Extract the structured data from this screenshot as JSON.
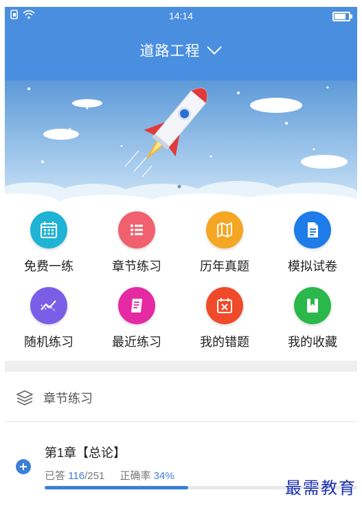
{
  "status": {
    "time": "14:14"
  },
  "header": {
    "title": "道路工程"
  },
  "menu": [
    {
      "label": "免费一练",
      "icon": "calendar-icon",
      "color": "#1fb3d6"
    },
    {
      "label": "章节练习",
      "icon": "list-icon",
      "color": "#f0606f"
    },
    {
      "label": "历年真题",
      "icon": "map-icon",
      "color": "#f5a623"
    },
    {
      "label": "模拟试卷",
      "icon": "document-icon",
      "color": "#1e7be8"
    },
    {
      "label": "随机练习",
      "icon": "random-chart-icon",
      "color": "#7a5ee8"
    },
    {
      "label": "最近练习",
      "icon": "book-icon",
      "color": "#e52aa4"
    },
    {
      "label": "我的错题",
      "icon": "error-calendar-icon",
      "color": "#ef4b2b"
    },
    {
      "label": "我的收藏",
      "icon": "bookmark-icon",
      "color": "#2bb84a"
    }
  ],
  "section": {
    "title": "章节练习"
  },
  "chapter": {
    "title": "第1章【总论】",
    "answered_label": "已答",
    "answered": "116",
    "sep": "/",
    "total": "251",
    "accuracy_label": "正确率",
    "accuracy": "34%",
    "progress": 0.46
  },
  "watermark": "最需教育"
}
